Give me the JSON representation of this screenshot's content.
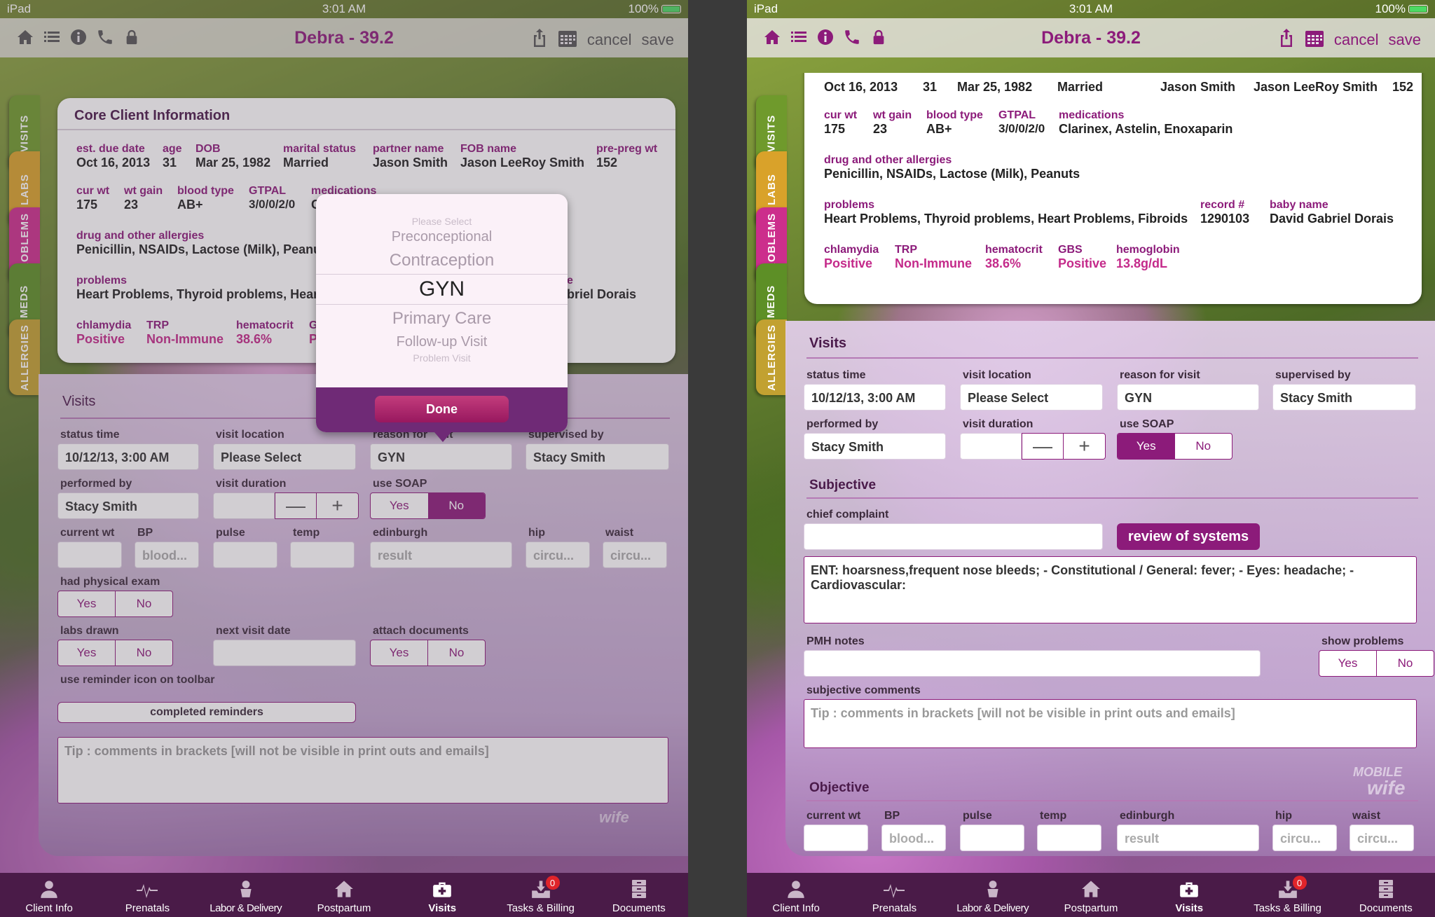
{
  "status": {
    "device": "iPad",
    "time": "3:01 AM",
    "battery": "100%"
  },
  "nav": {
    "title": "Debra - 39.2",
    "cancel": "cancel",
    "save": "save"
  },
  "sidetabs": [
    "VISITS",
    "LABS",
    "PROBLEMS",
    "MEDS",
    "ALLERGIES"
  ],
  "core": {
    "title": "Core Client Information",
    "est_due_label": "est. due date",
    "est_due": "Oct 16, 2013",
    "age_label": "age",
    "age": "31",
    "dob_label": "DOB",
    "dob": "Mar 25, 1982",
    "marital_label": "marital status",
    "marital": "Married",
    "partner_label": "partner name",
    "partner": "Jason Smith",
    "fob_label": "FOB name",
    "fob": "Jason LeeRoy Smith",
    "prepreg_label": "pre-preg wt",
    "prepreg": "152",
    "curwt_label": "cur wt",
    "curwt": "175",
    "wtgain_label": "wt gain",
    "wtgain": "23",
    "blood_label": "blood type",
    "blood": "AB+",
    "gtpal_label": "GTPAL",
    "gtpal": "3/0/0/2/0",
    "meds_label": "medications",
    "meds": "Clarinex, Astelin, Enoxaparin",
    "meds_partial": "C",
    "allergy_label": "drug and other allergies",
    "allergies": "Penicillin, NSAIDs, Lactose (Milk), Peanuts",
    "allergies_partial": "Penicillin, NSAIDs, Lactose (Milk), Peanu",
    "problems_label": "problems",
    "problems": "Heart Problems, Thyroid problems, Heart Problems, Fibroids",
    "problems_partial": "Heart Problems, Thyroid problems, Hear",
    "record_label": "record #",
    "record": "1290103",
    "baby_label": "baby name",
    "baby": "David Gabriel Dorais",
    "baby_label_partial": "e",
    "baby_partial": "briel Dorais",
    "chlamydia_label": "chlamydia",
    "chlamydia": "Positive",
    "trp_label": "TRP",
    "trp": "Non-Immune",
    "hema_label": "hematocrit",
    "hema": "38.6%",
    "gbs_label": "GBS",
    "gbs": "Positive",
    "gbs_label_partial": "G",
    "gbs_partial": "P",
    "hemo_label": "hemoglobin",
    "hemo": "13.8g/dL"
  },
  "visits": {
    "title": "Visits",
    "status_time_label": "status time",
    "status_time": "10/12/13, 3:00 AM",
    "location_label": "visit location",
    "location": "Please Select",
    "reason_label": "reason for visit",
    "reason_label_left_a": "reason for ",
    "reason_label_left_b": "it",
    "reason": "GYN",
    "supervised_label": "supervised by",
    "supervised": "Stacy Smith",
    "performed_label": "performed by",
    "performed": "Stacy Smith",
    "duration_label": "visit duration",
    "minus": "—",
    "plus": "+",
    "soap_label": "use SOAP",
    "yes": "Yes",
    "no": "No",
    "curwt_label": "current wt",
    "bp_label": "BP",
    "bp_ph": "blood...",
    "pulse_label": "pulse",
    "temp_label": "temp",
    "edinburgh_label": "edinburgh",
    "edinburgh_ph": "result",
    "hip_label": "hip",
    "hip_ph": "circu...",
    "waist_label": "waist",
    "waist_ph": "circu...",
    "physical_label": "had physical exam",
    "labs_label": "labs drawn",
    "next_visit_label": "next visit date",
    "attach_label": "attach documents",
    "reminder_label": "use reminder icon on toolbar",
    "completed_reminders": "completed reminders",
    "tip": "Tip : comments in brackets [will not be visible in print outs and emails]"
  },
  "subjective": {
    "title": "Subjective",
    "chief_label": "chief complaint",
    "ros_button": "review of systems",
    "ros_text": "ENT: hoarsness,frequent nose bleeds; - Constitutional / General: fever; - Eyes: headache; - Cardiovascular:",
    "pmh_label": "PMH notes",
    "show_problems_label": "show problems",
    "comments_label": "subjective comments"
  },
  "objective": {
    "title": "Objective"
  },
  "picker": {
    "options": [
      "Please Select",
      "Preconceptional",
      "Contraception",
      "GYN",
      "Primary Care",
      "Follow-up Visit",
      "Problem Visit"
    ],
    "done": "Done"
  },
  "tabbar": [
    {
      "label": "Client Info",
      "icon": "person-icon"
    },
    {
      "label": "Prenatals",
      "icon": "heartbeat-icon"
    },
    {
      "label": "Labor & Delivery",
      "icon": "baby-icon"
    },
    {
      "label": "Postpartum",
      "icon": "house-icon"
    },
    {
      "label": "Visits",
      "icon": "medical-bag-icon"
    },
    {
      "label": "Tasks & Billing",
      "icon": "inbox-icon",
      "badge": "0"
    },
    {
      "label": "Documents",
      "icon": "cabinet-icon"
    }
  ],
  "watermark": {
    "mobile": "MOBILE",
    "wife": "wife"
  }
}
